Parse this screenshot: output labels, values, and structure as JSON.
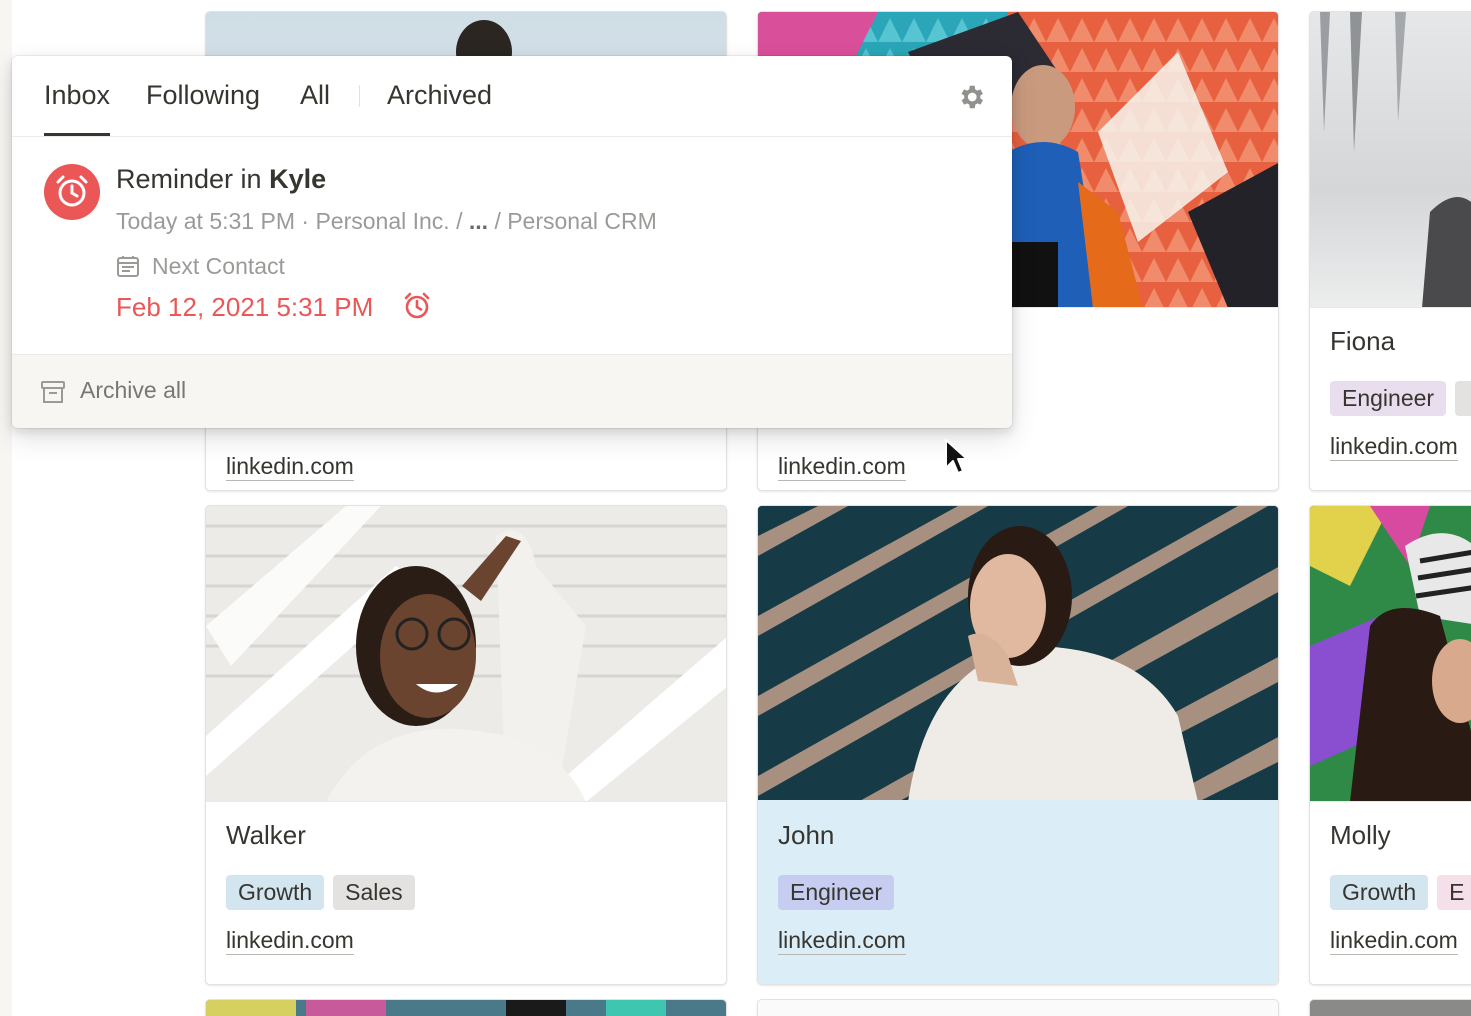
{
  "colors": {
    "accent_red": "#eb5757",
    "tag_growth": "#d3e5ef",
    "tag_sales": "#e3e2e0",
    "tag_engineer": "#e8deee",
    "tag_engineer_highlight": "#c7cdf1",
    "tag_pink": "#f5e0e9",
    "highlight_row": "#dbeef8"
  },
  "notifications_popup": {
    "tabs": [
      {
        "label": "Inbox",
        "active": true
      },
      {
        "label": "Following",
        "active": false
      },
      {
        "label": "All",
        "active": false
      },
      {
        "label": "Archived",
        "active": false
      }
    ],
    "settings_icon": "gear-icon",
    "item": {
      "icon": "alarm-clock-icon",
      "title_prefix": "Reminder in",
      "title_page": "Kyle",
      "time": "Today at 5:31 PM",
      "separator": "·",
      "path_start": "Personal Inc. /",
      "path_ellipsis": "...",
      "path_end": "/ Personal CRM",
      "property_icon": "calendar-icon",
      "property_label": "Next Contact",
      "property_value": "Feb 12, 2021 5:31 PM",
      "property_value_icon": "alarm-clock-icon"
    },
    "footer": {
      "icon": "archive-box-icon",
      "label": "Archive all"
    }
  },
  "gallery": {
    "cards": [
      {
        "name": "",
        "tags": [],
        "link": "linkedin.com"
      },
      {
        "name": "",
        "tags": [],
        "link": "linkedin.com"
      },
      {
        "name": "Fiona",
        "tags": [
          "Engineer"
        ],
        "link": "linkedin.com"
      },
      {
        "name": "Walker",
        "tags": [
          "Growth",
          "Sales"
        ],
        "link": "linkedin.com"
      },
      {
        "name": "John",
        "tags": [
          "Engineer"
        ],
        "link": "linkedin.com",
        "highlighted": true
      },
      {
        "name": "Molly",
        "tags": [
          "Growth",
          "E"
        ],
        "link": "linkedin.com"
      }
    ]
  }
}
